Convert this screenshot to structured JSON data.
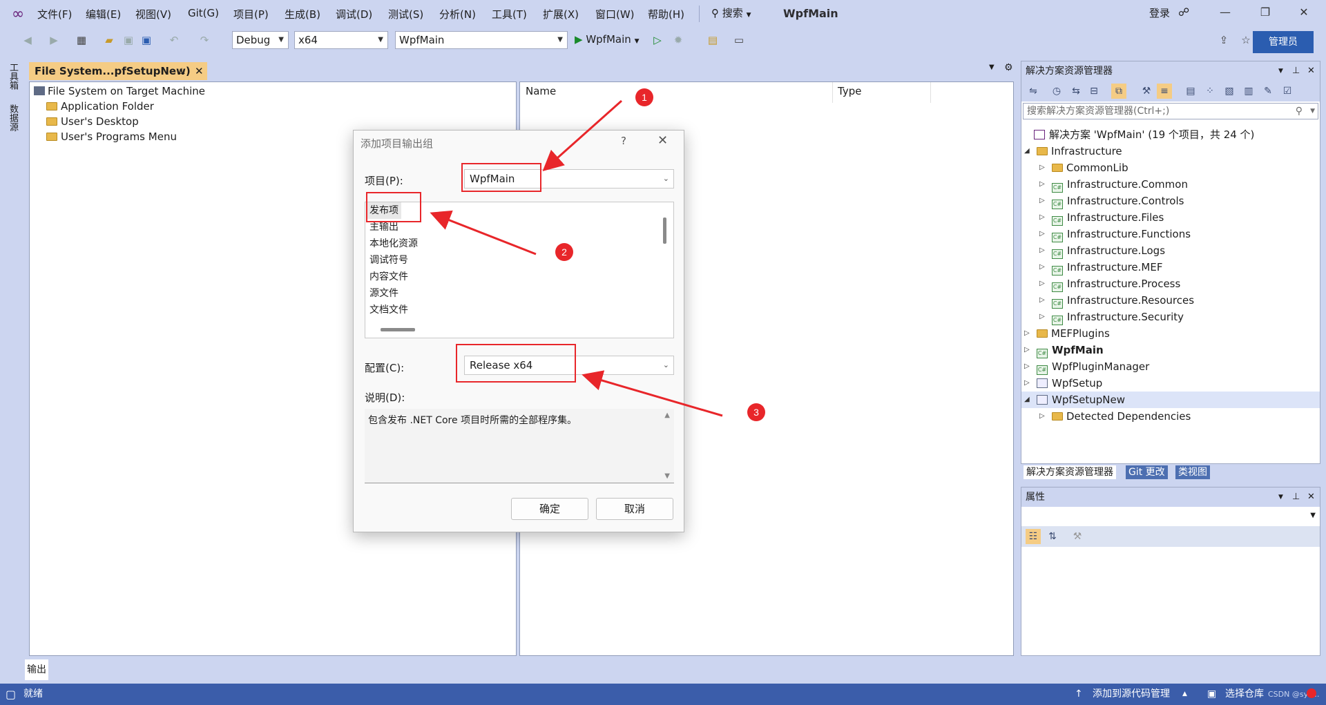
{
  "menu": [
    "文件(F)",
    "编辑(E)",
    "视图(V)",
    "Git(G)",
    "项目(P)",
    "生成(B)",
    "调试(D)",
    "测试(S)",
    "分析(N)",
    "工具(T)",
    "扩展(X)",
    "窗口(W)",
    "帮助(H)"
  ],
  "search_label": "搜索",
  "window_title": "WpfMain",
  "login_label": "登录",
  "admin_label": "管理员",
  "toolbar": {
    "config": "Debug",
    "platform": "x64",
    "startup_project": "WpfMain",
    "run_label": "WpfMain"
  },
  "left_strip": {
    "toolbox": "工具箱",
    "datasource": "数据源"
  },
  "document_tab": {
    "label": "File System...pfSetupNew)"
  },
  "file_system_tree": {
    "root": "File System on Target Machine",
    "children": [
      "Application Folder",
      "User's Desktop",
      "User's Programs Menu"
    ]
  },
  "columns": {
    "name": "Name",
    "type": "Type"
  },
  "solution_explorer": {
    "title": "解决方案资源管理器",
    "search_placeholder": "搜索解决方案资源管理器(Ctrl+;)",
    "solution_label": "解决方案 'WpfMain' (19 个项目，共 24 个)",
    "items": [
      {
        "label": "Infrastructure",
        "level": 1,
        "kind": "folder",
        "expanded": true
      },
      {
        "label": "CommonLib",
        "level": 2,
        "kind": "folder"
      },
      {
        "label": "Infrastructure.Common",
        "level": 2,
        "kind": "project"
      },
      {
        "label": "Infrastructure.Controls",
        "level": 2,
        "kind": "project"
      },
      {
        "label": "Infrastructure.Files",
        "level": 2,
        "kind": "project"
      },
      {
        "label": "Infrastructure.Functions",
        "level": 2,
        "kind": "project"
      },
      {
        "label": "Infrastructure.Logs",
        "level": 2,
        "kind": "project"
      },
      {
        "label": "Infrastructure.MEF",
        "level": 2,
        "kind": "project"
      },
      {
        "label": "Infrastructure.Process",
        "level": 2,
        "kind": "project"
      },
      {
        "label": "Infrastructure.Resources",
        "level": 2,
        "kind": "project"
      },
      {
        "label": "Infrastructure.Security",
        "level": 2,
        "kind": "project"
      },
      {
        "label": "MEFPlugins",
        "level": 1,
        "kind": "folder"
      },
      {
        "label": "WpfMain",
        "level": 1,
        "kind": "project",
        "bold": true
      },
      {
        "label": "WpfPluginManager",
        "level": 1,
        "kind": "project"
      },
      {
        "label": "WpfSetup",
        "level": 1,
        "kind": "setup"
      },
      {
        "label": "WpfSetupNew",
        "level": 1,
        "kind": "setup",
        "expanded": true,
        "selected": true
      },
      {
        "label": "Detected Dependencies",
        "level": 2,
        "kind": "folder"
      }
    ],
    "bottom_tabs": [
      "解决方案资源管理器",
      "Git 更改",
      "类视图"
    ]
  },
  "properties": {
    "title": "属性"
  },
  "output_tab": "输出",
  "status": {
    "ready": "就绪",
    "add_source_control": "添加到源代码管理",
    "select_repo": "选择仓库",
    "watermark": "CSDN @syz..."
  },
  "dialog": {
    "title": "添加项目输出组",
    "help": "?",
    "project_label": "项目(P):",
    "project_value": "WpfMain",
    "groups": [
      "发布项",
      "主输出",
      "本地化资源",
      "调试符号",
      "内容文件",
      "源文件",
      "文档文件"
    ],
    "selected_group": "发布项",
    "config_label": "配置(C):",
    "config_value": "Release x64",
    "desc_label": "说明(D):",
    "desc_text": "包含发布 .NET Core 项目时所需的全部程序集。",
    "ok": "确定",
    "cancel": "取消"
  },
  "annotations": [
    "1",
    "2",
    "3"
  ],
  "colors": {
    "accent_tab": "#f5cc84",
    "chrome": "#ccd5f0",
    "status": "#3b5daa",
    "annotation": "#e8262a"
  }
}
